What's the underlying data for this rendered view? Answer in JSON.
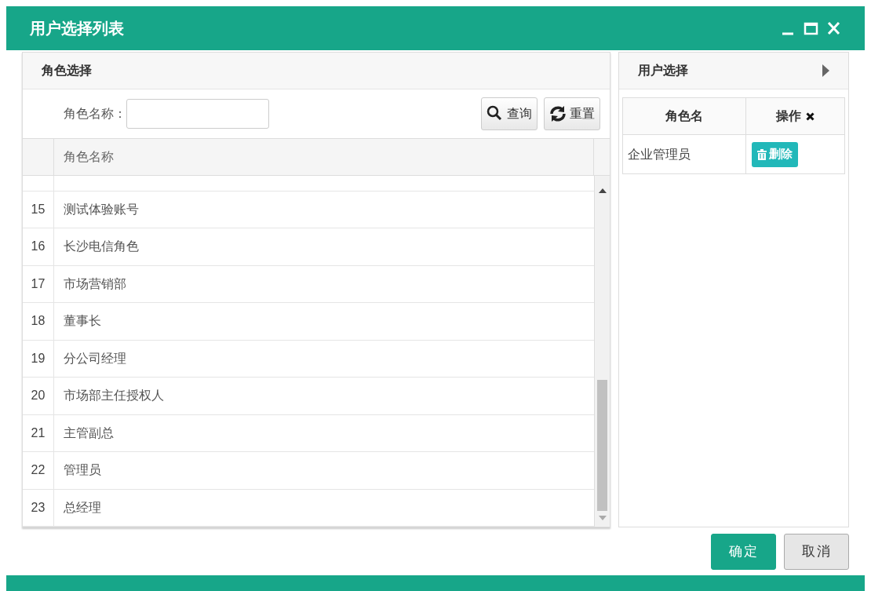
{
  "window": {
    "title": "用户选择列表"
  },
  "role_panel": {
    "title": "角色选择",
    "search": {
      "label": "角色名称："
    },
    "buttons": [
      {
        "kind": "search",
        "label": "查询"
      },
      {
        "kind": "reset",
        "label": "重置"
      }
    ],
    "table": {
      "columns": [
        "角色名称"
      ],
      "rows": [
        {
          "number": "15",
          "name": "测试体验账号"
        },
        {
          "number": "16",
          "name": "长沙电信角色"
        },
        {
          "number": "17",
          "name": "市场营销部"
        },
        {
          "number": "18",
          "name": "董事长"
        },
        {
          "number": "19",
          "name": "分公司经理"
        },
        {
          "number": "20",
          "name": "市场部主任授权人"
        },
        {
          "number": "21",
          "name": "主管副总"
        },
        {
          "number": "22",
          "name": "管理员"
        },
        {
          "number": "23",
          "name": "总经理"
        }
      ]
    }
  },
  "user_panel": {
    "title": "用户选择",
    "table": {
      "columns": [
        "角色名",
        "操作"
      ],
      "rows": [
        {
          "name": "企业管理员",
          "action": "删除"
        }
      ]
    }
  },
  "buttons": [
    {
      "kind": "primary",
      "label": "确定"
    },
    {
      "kind": "default",
      "label": "取消"
    }
  ]
}
